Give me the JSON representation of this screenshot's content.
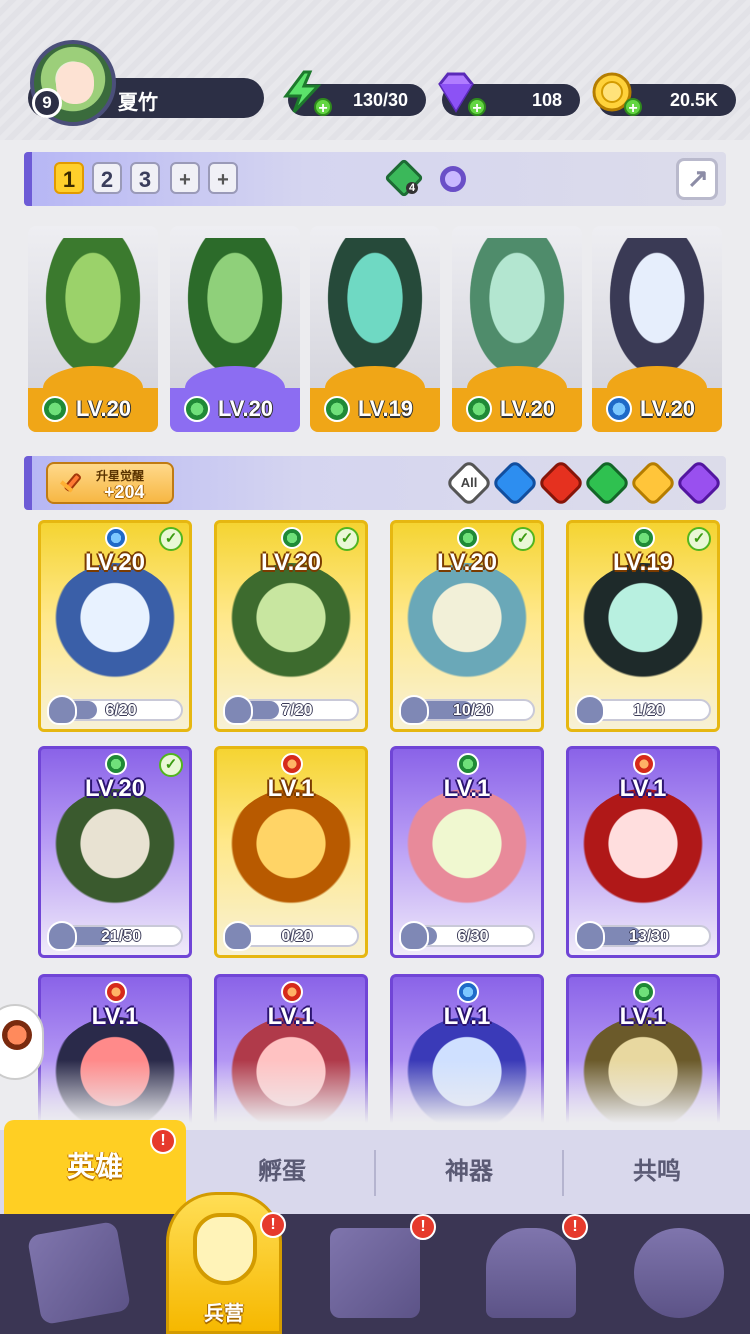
{
  "player": {
    "name": "夏竹",
    "level": "9"
  },
  "resources": {
    "energy": "130/30",
    "gems": "108",
    "gold": "20.5K"
  },
  "team": {
    "tabs": [
      "1",
      "2",
      "3"
    ],
    "add_slots": [
      "+",
      "+"
    ],
    "gem_count": "4",
    "members": [
      {
        "level": "LV.20",
        "element": "wind",
        "frame": "gold"
      },
      {
        "level": "LV.20",
        "element": "wind",
        "frame": "purple"
      },
      {
        "level": "LV.19",
        "element": "wind",
        "frame": "gold"
      },
      {
        "level": "LV.20",
        "element": "wind",
        "frame": "gold"
      },
      {
        "level": "LV.20",
        "element": "water",
        "frame": "gold"
      }
    ]
  },
  "awaken": {
    "title": "升星觉醒",
    "value": "+204"
  },
  "filters": [
    {
      "key": "all",
      "label": "All"
    },
    {
      "key": "water"
    },
    {
      "key": "fire"
    },
    {
      "key": "wind"
    },
    {
      "key": "light"
    },
    {
      "key": "dark"
    }
  ],
  "heroes": [
    {
      "level": "LV.20",
      "element": "water",
      "frame": "gold",
      "shards": "6/20",
      "progress": 0.3,
      "checked": true
    },
    {
      "level": "LV.20",
      "element": "wind",
      "frame": "gold",
      "shards": "7/20",
      "progress": 0.35,
      "checked": true
    },
    {
      "level": "LV.20",
      "element": "wind",
      "frame": "gold",
      "shards": "10/20",
      "progress": 0.5,
      "checked": true
    },
    {
      "level": "LV.19",
      "element": "wind",
      "frame": "gold",
      "shards": "1/20",
      "progress": 0.05,
      "checked": true
    },
    {
      "level": "LV.20",
      "element": "wind",
      "frame": "purple",
      "shards": "21/50",
      "progress": 0.42,
      "checked": true
    },
    {
      "level": "LV.1",
      "element": "fire",
      "frame": "gold",
      "shards": "0/20",
      "progress": 0.0,
      "checked": false
    },
    {
      "level": "LV.1",
      "element": "wind",
      "frame": "purple",
      "shards": "6/30",
      "progress": 0.2,
      "checked": false
    },
    {
      "level": "LV.1",
      "element": "fire",
      "frame": "purple",
      "shards": "13/30",
      "progress": 0.43,
      "checked": false
    },
    {
      "level": "LV.1",
      "element": "fire",
      "frame": "purple",
      "shards": "",
      "progress": 0,
      "checked": false
    },
    {
      "level": "LV.1",
      "element": "fire",
      "frame": "purple",
      "shards": "",
      "progress": 0,
      "checked": false
    },
    {
      "level": "LV.1",
      "element": "water",
      "frame": "purple",
      "shards": "",
      "progress": 0,
      "checked": false
    },
    {
      "level": "LV.1",
      "element": "wind",
      "frame": "purple",
      "shards": "",
      "progress": 0,
      "checked": false
    }
  ],
  "subtabs": [
    "英雄",
    "孵蛋",
    "神器",
    "共鸣"
  ],
  "nav": {
    "barracks_label": "兵营"
  },
  "colors": {
    "gold": "#f5d432",
    "purple": "#8a63e8",
    "accent": "#ffcf23",
    "nav_bg": "#3b3654"
  }
}
